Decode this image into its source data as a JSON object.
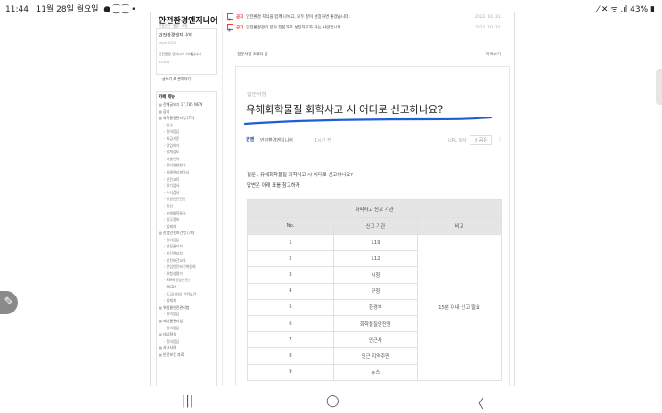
{
  "status_bar": {
    "time": "11:44",
    "date": "11월 28일 월요일",
    "icons_left": "● ⁐ ⁐ •",
    "icons_right": "⁄ ✕ ᯤ .ıl",
    "battery": "43%"
  },
  "sidebar": {
    "cafe_title": "안전환경엔지니어",
    "cafe_sub": "산업안전 · 환경 · 소방",
    "cafe_name": "안전환경엔지니어",
    "cafe_info": "since 2020",
    "cafe_desc": "안전환경 엔지니어 카페입니다",
    "cafe_level": "1100명",
    "links": "글쓰기   ⚙ 관리하기",
    "menu_title": "카페 메뉴",
    "menu": [
      {
        "label": "▤ 전체글보기  17,785  NEW",
        "indent": false
      },
      {
        "label": "▤ 공지",
        "indent": false
      },
      {
        "label": "▤ 화학물질관리법 [73]",
        "indent": false
      },
      {
        "label": "· 법규",
        "indent": true
      },
      {
        "label": "· 질의응답",
        "indent": true
      },
      {
        "label": "· 취급기준",
        "indent": true
      },
      {
        "label": "· 영업허가",
        "indent": true
      },
      {
        "label": "· 설계검토",
        "indent": true
      },
      {
        "label": "· 기술인력",
        "indent": true
      },
      {
        "label": "· 장외영향평가",
        "indent": true
      },
      {
        "label": "· 위해관리계획서",
        "indent": true
      },
      {
        "label": "· 안전교육",
        "indent": true
      },
      {
        "label": "· 정기검사",
        "indent": true
      },
      {
        "label": "· 수시검사",
        "indent": true
      },
      {
        "label": "· 정밀안전진단",
        "indent": true
      },
      {
        "label": "· 점검",
        "indent": true
      },
      {
        "label": "· 유해화학물질",
        "indent": true
      },
      {
        "label": "· 실무정보",
        "indent": true
      },
      {
        "label": "· 법제처",
        "indent": true
      },
      {
        "label": "▤ 산업안전보건법 [78]",
        "indent": false
      },
      {
        "label": "· 질의응답",
        "indent": true
      },
      {
        "label": "· 안전관리자",
        "indent": true
      },
      {
        "label": "· 보건관리자",
        "indent": true
      },
      {
        "label": "· 안전보건교육",
        "indent": true
      },
      {
        "label": "· 산업안전보건위원회",
        "indent": true
      },
      {
        "label": "· 위험성평가",
        "indent": true
      },
      {
        "label": "· PSM(공정안전)",
        "indent": true
      },
      {
        "label": "· MSDS",
        "indent": true
      },
      {
        "label": "· 도급(계약) 안전보건",
        "indent": true
      },
      {
        "label": "· 법제처",
        "indent": true
      },
      {
        "label": "▤ 위험물안전관리법",
        "indent": false
      },
      {
        "label": "· 질의응답",
        "indent": true
      },
      {
        "label": "▤ 폐기물관리법",
        "indent": false
      },
      {
        "label": "· 질의응답",
        "indent": true
      },
      {
        "label": "▤ 대기환경",
        "indent": false
      },
      {
        "label": "· 질의응답",
        "indent": true
      },
      {
        "label": "▤ 사고사례",
        "indent": false
      },
      {
        "label": "▤ 안전보건 자료",
        "indent": false
      }
    ]
  },
  "notices": [
    {
      "check": "공",
      "tag": "공지",
      "text": "안전환경 지식을 함께 나누고, 모두 같이 성장하면 좋겠습니다.",
      "date": "2022. 10. 31."
    },
    {
      "check": "공",
      "tag": "공지",
      "text": "안전환경관리 분야 전문가로 성장하고자 하는 사람입니다.",
      "date": "2022. 10. 31."
    }
  ],
  "board_bar": {
    "count_label": "질문사항 3개의 글",
    "list_link": "목록보기"
  },
  "post": {
    "board": "질문사항",
    "title": "유해화학물질 화학사고 시 어디로 신고하나요?",
    "author_avatar": "권엔",
    "author": "안전환경엔지니어",
    "time": "1시간 전",
    "url_copy": "URL 복사",
    "share": "⇪ 공유",
    "more": "⋮",
    "question": "질문 : 유해화학물질 화학사고 시 어디로 신고하나요?",
    "answer": "답변은 아래 표를 참고하자"
  },
  "report_table": {
    "caption": "화학사고 신고 기관",
    "headers": [
      "No.",
      "신고 기관",
      "비고"
    ],
    "rows": [
      {
        "no": "1",
        "agency": "119"
      },
      {
        "no": "2",
        "agency": "112"
      },
      {
        "no": "3",
        "agency": "시청"
      },
      {
        "no": "4",
        "agency": "구청"
      },
      {
        "no": "5",
        "agency": "환경부"
      },
      {
        "no": "6",
        "agency": "화학물질안전원"
      },
      {
        "no": "7",
        "agency": "인근사"
      },
      {
        "no": "8",
        "agency": "인근 지역주민"
      },
      {
        "no": "9",
        "agency": "뉴스"
      }
    ],
    "note": "15분 이내 신고 필요"
  },
  "nav_bar": {
    "recents": "|||",
    "home": "◯",
    "back": "〈"
  },
  "colors": {
    "accent_red": "#e33333",
    "underline_blue": "#1f5fd6",
    "table_header": "#e5e5e5"
  }
}
